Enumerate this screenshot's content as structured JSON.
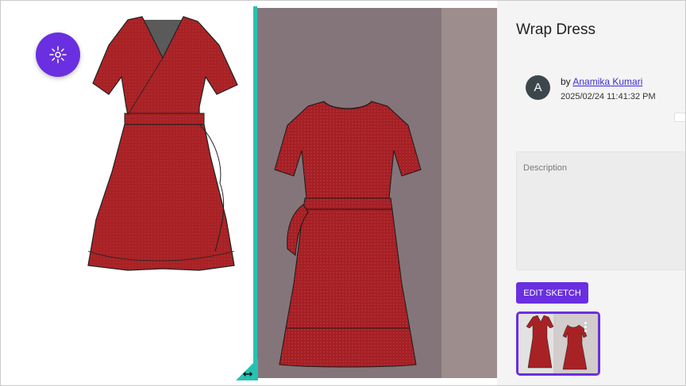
{
  "viewer": {
    "magic_button": {
      "icon": "sparkle-icon",
      "color": "#6a2fe0"
    },
    "divider_color": "#27c1b1",
    "resize_handle_icon": "resize-horizontal-icon",
    "fabric_color": "#a82125"
  },
  "sidebar": {
    "title": "Wrap Dress",
    "author": {
      "avatar_initial": "A",
      "by_prefix": "by",
      "name": "Anamika Kumari",
      "date": "2025/02/24 11:41:32 PM"
    },
    "description_placeholder": "Description",
    "edit_button_label": "EDIT SKETCH",
    "thumbnail": {
      "menu_icon": "more-vertical-icon"
    }
  },
  "colors": {
    "accent": "#6a2fe0"
  }
}
